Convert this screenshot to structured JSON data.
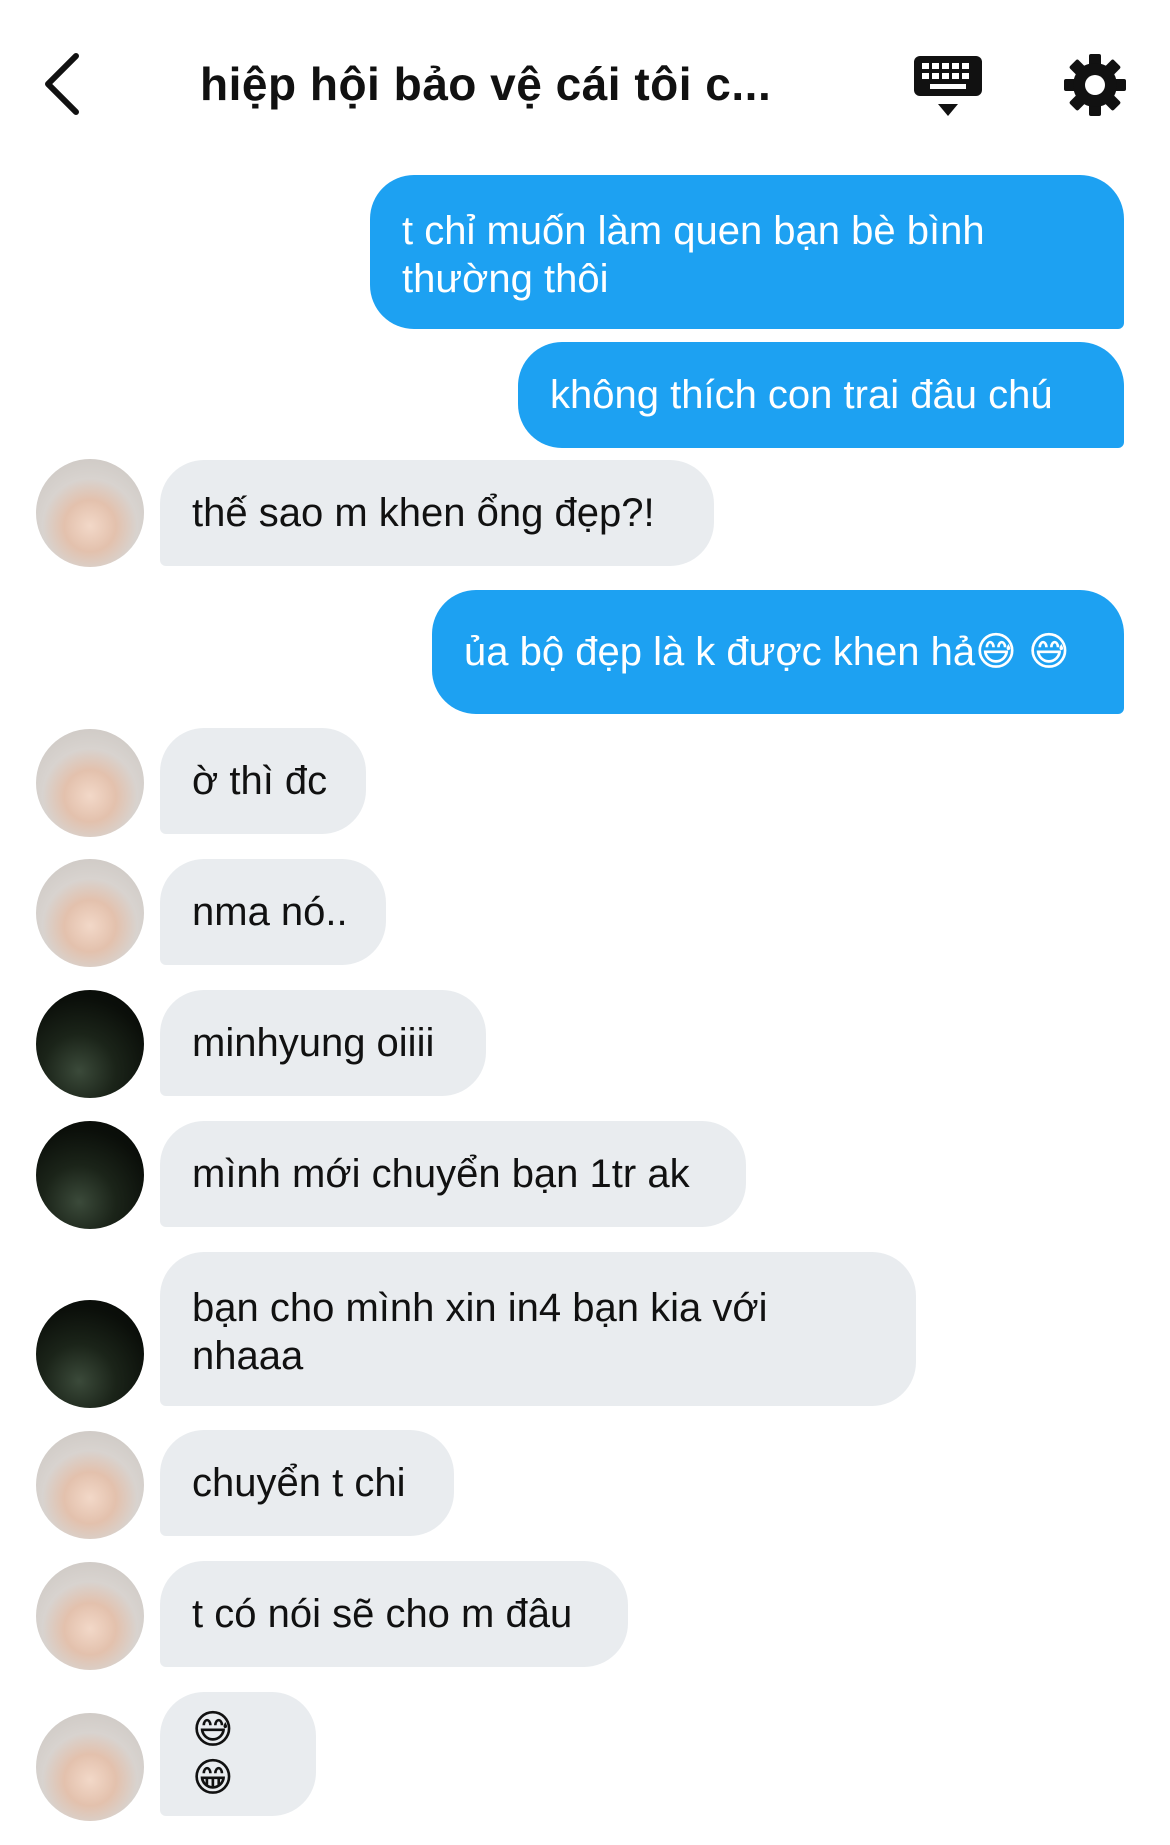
{
  "header": {
    "title": "hiệp hội bảo vệ cái tôi c..."
  },
  "messages": [
    {
      "text": "t chỉ muốn làm quen bạn bè bình\nthường thôi"
    },
    {
      "text": "không thích con trai đâu chú"
    },
    {
      "text": "thế sao m khen ổng đẹp?!"
    },
    {
      "text": "ủa bộ đẹp là k được khen hả😅 😅"
    },
    {
      "text": "ờ thì đc"
    },
    {
      "text": "nma nó.."
    },
    {
      "text": "minhyung oiiii"
    },
    {
      "text": "mình mới chuyển bạn 1tr ak"
    },
    {
      "text": "bạn cho mình xin in4 bạn kia với\nnhaaa"
    },
    {
      "text": "chuyển t chi"
    },
    {
      "text": "t có nói sẽ cho m đâu"
    },
    {
      "text": "😅 😁"
    }
  ],
  "colors": {
    "outgoing_bubble": "#1da1f2",
    "incoming_bubble": "#e9ecef"
  }
}
